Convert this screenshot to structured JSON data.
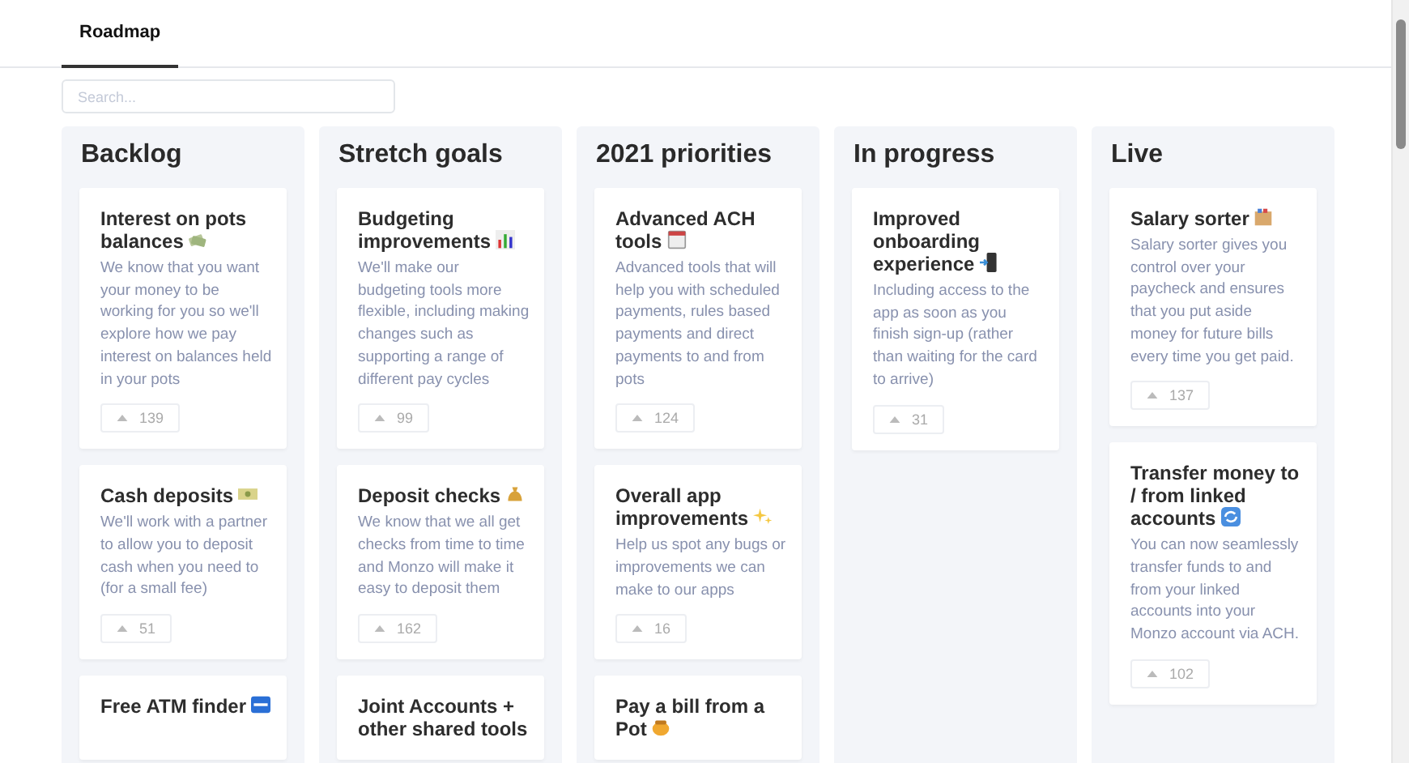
{
  "tabs": [
    {
      "label": "Roadmap",
      "selected": true
    }
  ],
  "search": {
    "placeholder": "Search..."
  },
  "columns": [
    {
      "title": "Backlog",
      "cards": [
        {
          "title": "Interest on pots balances",
          "description": "We know that you want your money to be working for you so we'll explore how we pay interest on balances held in your pots",
          "votes": "139"
        },
        {
          "title": "Cash deposits",
          "description": "We'll work with a partner to allow you to deposit cash when you need to (for a small fee)",
          "votes": "51"
        },
        {
          "title": "Free ATM finder"
        }
      ]
    },
    {
      "title": "Stretch goals",
      "cards": [
        {
          "title": "Budgeting improvements",
          "description": "We'll make our budgeting tools more flexible, including making changes such as supporting a range of different pay cycles",
          "votes": "99"
        },
        {
          "title": "Deposit checks",
          "description": "We know that we all get checks from time to time and Monzo will make it easy to deposit them",
          "votes": "162"
        },
        {
          "title": "Joint Accounts + other shared tools"
        }
      ]
    },
    {
      "title": "2021 priorities",
      "cards": [
        {
          "title": "Advanced ACH tools",
          "description": "Advanced tools that will help you with scheduled payments, rules based payments and direct payments to and from pots",
          "votes": "124"
        },
        {
          "title": "Overall app improvements",
          "description": "Help us spot any bugs or improvements we can make to our apps",
          "votes": "16"
        },
        {
          "title": "Pay a bill from a Pot"
        }
      ]
    },
    {
      "title": "In progress",
      "cards": [
        {
          "title": "Improved onboarding experience",
          "description": "Including access to the app as soon as you finish sign-up (rather than waiting for the card to arrive)",
          "votes": "31"
        }
      ]
    },
    {
      "title": "Live",
      "cards": [
        {
          "title": "Salary sorter",
          "description": "Salary sorter gives you control over your paycheck and ensures that you put aside money for future bills every time you get paid.",
          "votes": "137"
        },
        {
          "title": "Transfer money to / from linked accounts",
          "description": "You can now seamlessly transfer funds to and from your linked accounts into your Monzo account via ACH.",
          "votes": "102"
        }
      ]
    }
  ]
}
